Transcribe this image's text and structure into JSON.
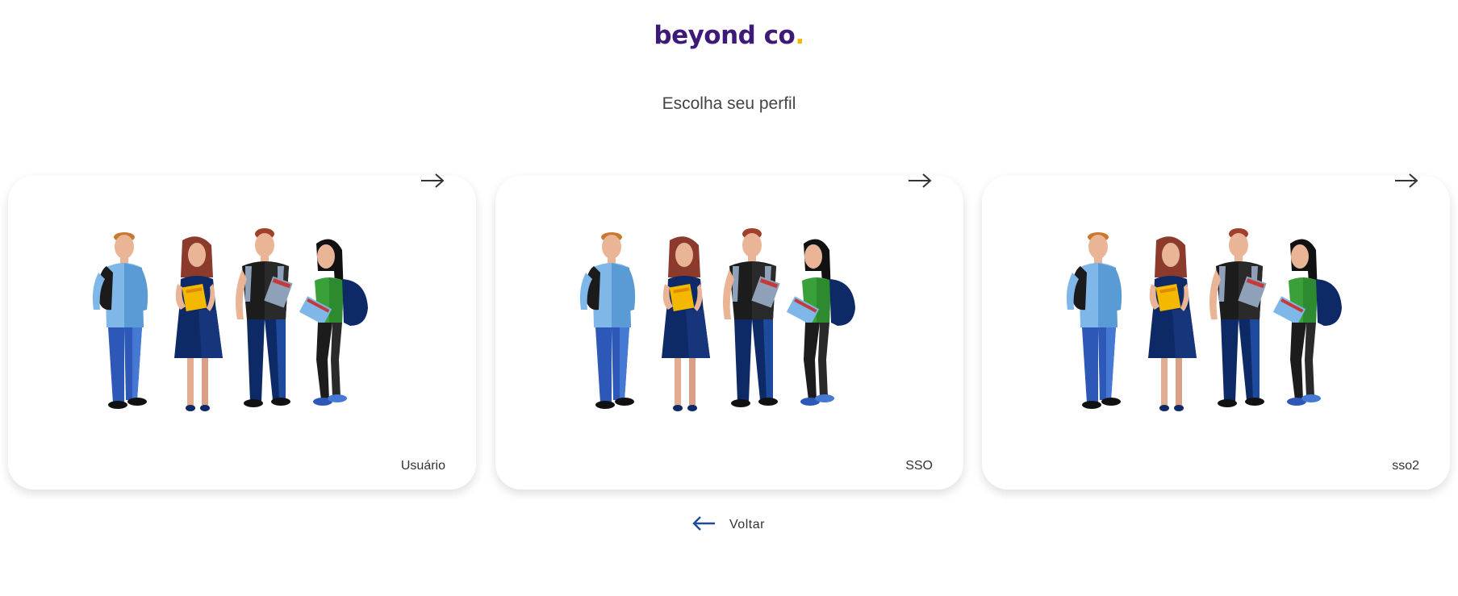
{
  "logo": {
    "name": "beyond co",
    "dot": "."
  },
  "subtitle": "Escolha seu perfil",
  "cards": [
    {
      "label": "Usuário",
      "icon": "arrow-right-icon"
    },
    {
      "label": "SSO",
      "icon": "arrow-right-icon"
    },
    {
      "label": "sso2",
      "icon": "arrow-right-icon"
    }
  ],
  "back": {
    "label": "Voltar",
    "icon": "arrow-left-icon"
  },
  "colors": {
    "brand": "#3d1a78",
    "accent": "#f2b705",
    "back_arrow": "#1d4e8f"
  }
}
